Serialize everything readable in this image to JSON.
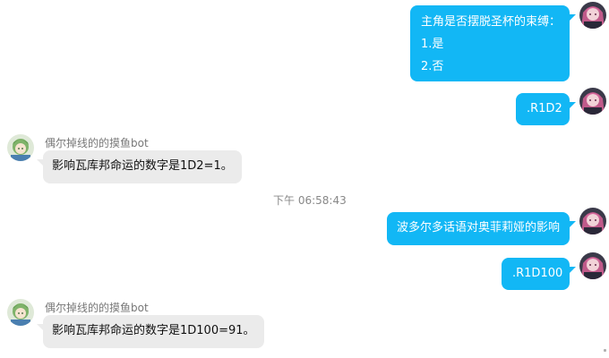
{
  "messages": [
    {
      "from": "self",
      "lines": [
        "主角是否摆脱圣杯的束缚：",
        "1.是",
        "2.否"
      ]
    },
    {
      "from": "self",
      "text": ".R1D2"
    },
    {
      "from": "bot",
      "sender": "偶尔掉线的的摸鱼bot",
      "text": "影响瓦库邦命运的数字是1D2=1。"
    },
    {
      "timestamp": "下午 06:58:43"
    },
    {
      "from": "self",
      "text": "波多尔多话语对奥菲莉娅的影响"
    },
    {
      "from": "self",
      "text": ".R1D100"
    },
    {
      "from": "bot",
      "sender": "偶尔掉线的的摸鱼bot",
      "text": "影响瓦库邦命运的数字是1D100=91。"
    }
  ],
  "colors": {
    "self_bubble": "#12b7f5",
    "other_bubble": "#ebebeb",
    "background": "#ffffff"
  },
  "icons": {
    "self_avatar": "anime-girl-pink-hair-avatar-icon",
    "bot_avatar": "anime-girl-green-hair-avatar-icon"
  }
}
